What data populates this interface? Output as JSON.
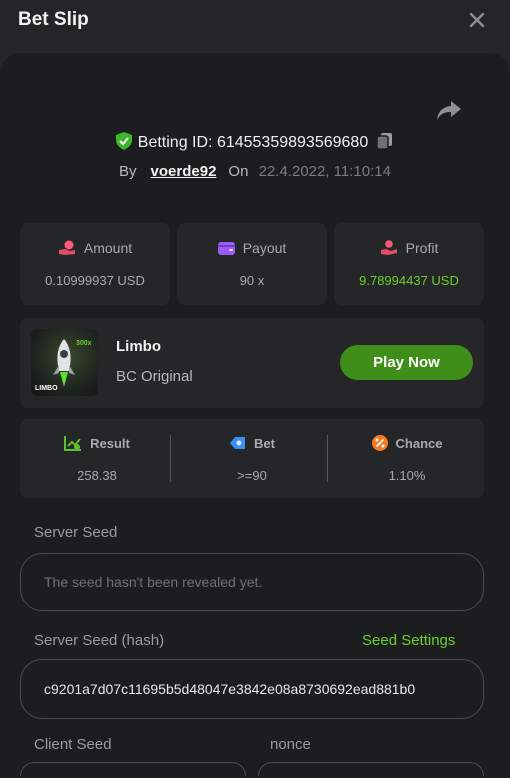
{
  "header": {
    "title": "Bet Slip"
  },
  "bet": {
    "id_label": "Betting ID:",
    "id_value": "61455359893569680",
    "by_label": "By",
    "username": "voerde92",
    "on_label": "On",
    "date": "22.4.2022, 11:10:14"
  },
  "stats": {
    "amount": {
      "label": "Amount",
      "value": "0.10999937 USD"
    },
    "payout": {
      "label": "Payout",
      "value": "90 x"
    },
    "profit": {
      "label": "Profit",
      "value": "9.78994437 USD"
    }
  },
  "game": {
    "name": "Limbo",
    "subtitle": "BC Original",
    "play_label": "Play Now",
    "thumb_caption": "LIMBO",
    "thumb_multiplier": "300x"
  },
  "result_row": {
    "result": {
      "label": "Result",
      "value": "258.38"
    },
    "bet": {
      "label": "Bet",
      "value": ">=90"
    },
    "chance": {
      "label": "Chance",
      "value": "1.10%"
    }
  },
  "seeds": {
    "server_seed_label": "Server Seed",
    "server_seed_placeholder": "The seed hasn't been revealed yet.",
    "server_hash_label": "Server Seed (hash)",
    "seed_settings_label": "Seed Settings",
    "server_hash_value": "c9201a7d07c11695b5d48047e3842e08a8730692ead881b0",
    "client_seed_label": "Client Seed",
    "nonce_label": "nonce"
  },
  "colors": {
    "accent_green": "#6bd02a",
    "button_green": "#3f8e1a",
    "panel_bg": "#1b1d1f",
    "card_bg": "#242628"
  },
  "icons": {
    "close": "close-icon",
    "share": "share-arrow-icon",
    "verified": "shield-check-icon",
    "copy": "copy-icon",
    "amount": "coin-hand-icon",
    "payout": "wallet-icon",
    "profit": "profit-hand-icon",
    "result": "chart-check-icon",
    "bet": "bet-ticket-icon",
    "chance": "percent-icon"
  }
}
